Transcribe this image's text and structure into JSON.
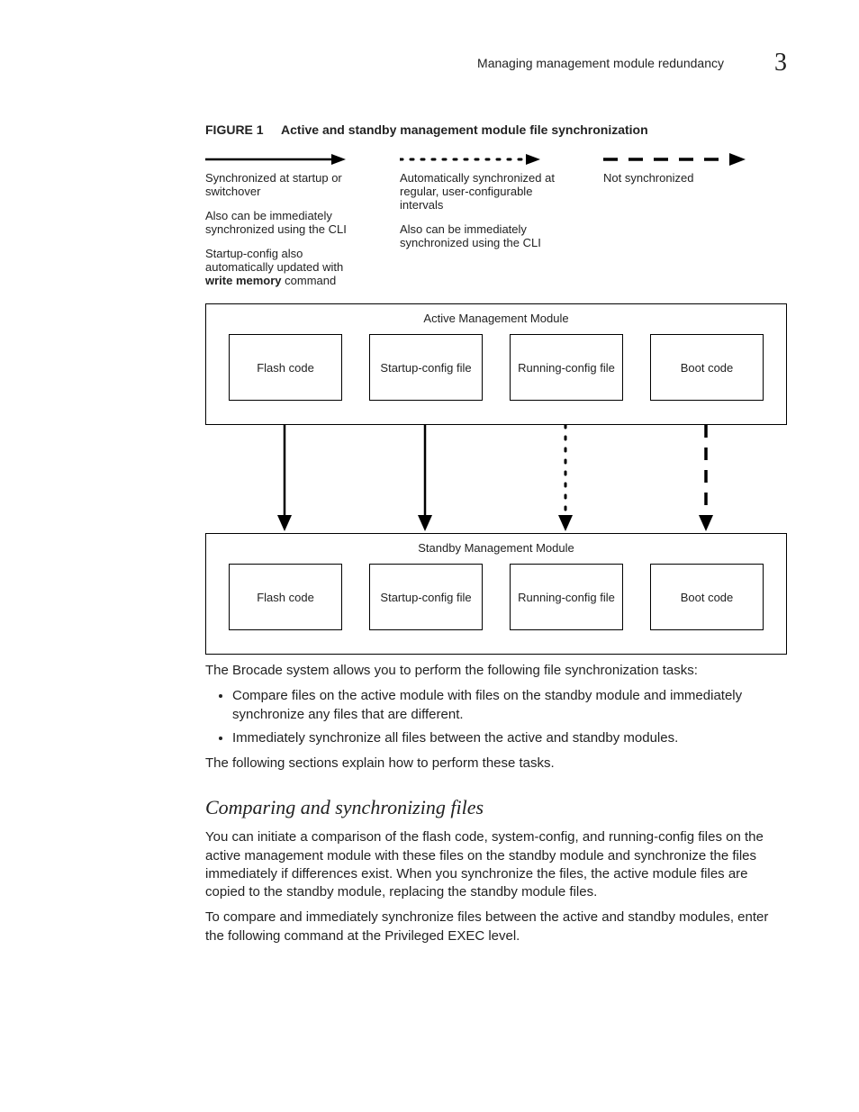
{
  "header": {
    "running": "Managing management module redundancy",
    "chapter": "3"
  },
  "figure": {
    "label": "FIGURE 1",
    "title": "Active and standby management module file synchronization"
  },
  "legend": {
    "col1": {
      "a": "Synchronized at startup or switchover",
      "b": "Also can be immediately synchronized using the CLI",
      "c_pre": "Startup-config also automatically updated with ",
      "c_bold": "write memory",
      "c_post": " command"
    },
    "col2": {
      "a": "Automatically synchronized at regular, user-configurable intervals",
      "b": "Also can be immediately synchronized using the CLI"
    },
    "col3": {
      "a": "Not synchronized"
    }
  },
  "modules": {
    "active": "Active Management Module",
    "standby": "Standby Management Module",
    "boxes": [
      "Flash code",
      "Startup-config file",
      "Running-config file",
      "Boot code"
    ]
  },
  "body": {
    "p1": "The Brocade system allows you to perform the following file synchronization tasks:",
    "b1": "Compare files on the active module with files on the standby module and immediately synchronize any files that are different.",
    "b2": "Immediately synchronize all files between the active and standby modules.",
    "p2": "The following sections explain how to perform these tasks.",
    "h3": "Comparing and synchronizing files",
    "p3": "You can initiate a comparison of the flash code, system-config, and running-config files on the active management module with these files on the standby module and synchronize the files immediately if differences exist. When you synchronize the files, the active module files are copied to the standby module, replacing the standby module files.",
    "p4": "To compare and immediately synchronize files between the active and standby modules, enter the following command at the Privileged EXEC level."
  }
}
